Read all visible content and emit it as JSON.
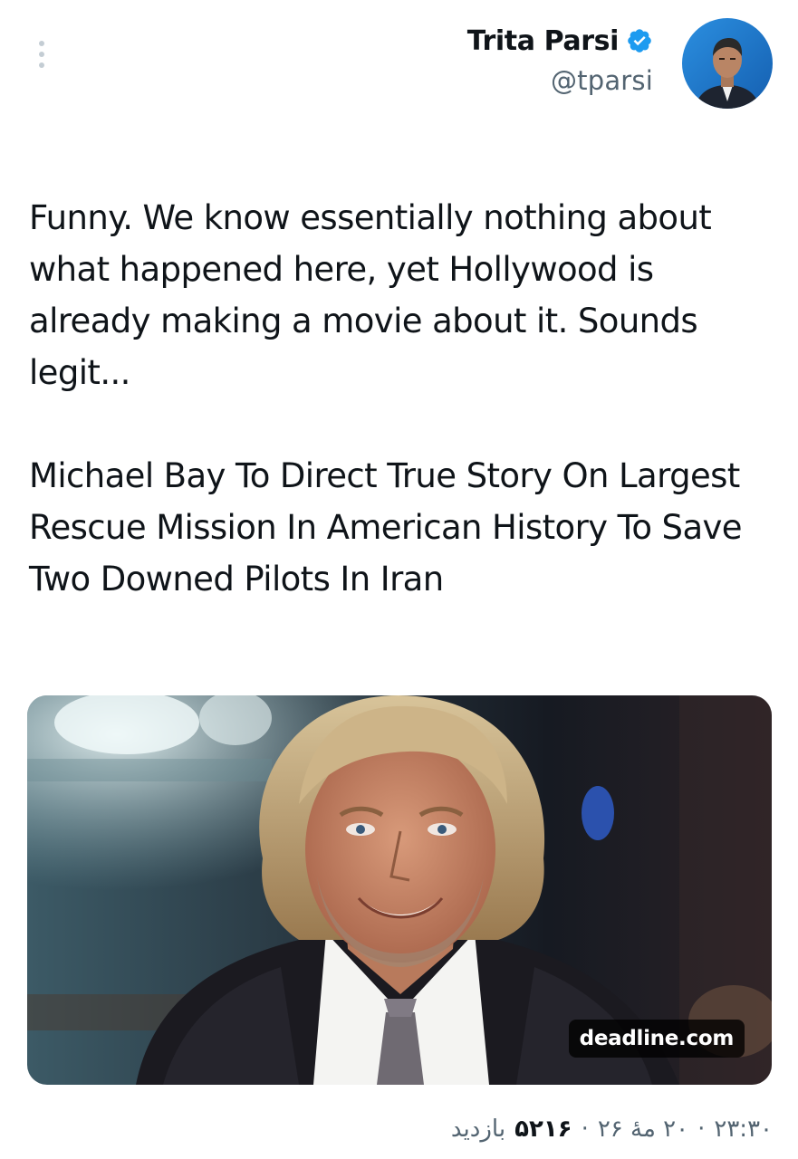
{
  "author": {
    "name": "Trita Parsi",
    "handle": "@tparsi",
    "verified_icon": "verified-badge-icon",
    "verified_color": "#1d9bf0"
  },
  "tweet": {
    "text_paragraph_1": "Funny. We know essentially nothing about what happened here, yet Hollywood is already making a movie about it. Sounds legit...",
    "text_paragraph_2": "Michael Bay To Direct True Story On Largest Rescue Mission In American History To Save Two Downed Pilots In Iran"
  },
  "link_card": {
    "domain": "deadline.com",
    "image_icon": "portrait-photo"
  },
  "meta": {
    "time": "۲۳:۳۰",
    "separator": "·",
    "date": "۲۰ مهٔ ۲۶",
    "views_count": "۵۲۱۶",
    "views_label": "بازدید"
  },
  "colors": {
    "text": "#0f1419",
    "secondary_text": "#536471",
    "accent": "#1d9bf0"
  }
}
